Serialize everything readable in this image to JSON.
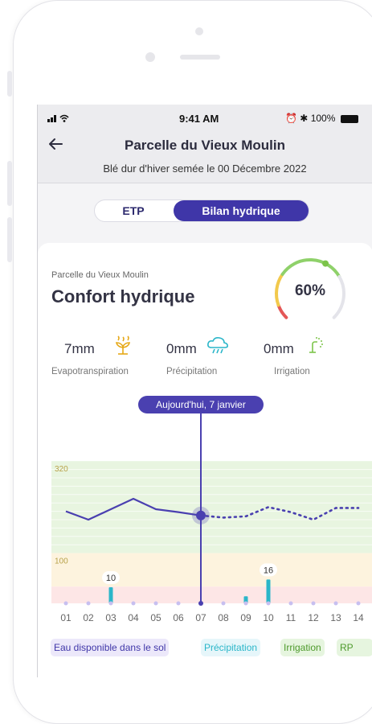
{
  "status": {
    "time": "9:41 AM",
    "battery": "100%"
  },
  "header": {
    "back_icon": "arrow-left-icon",
    "title": "Parcelle du Vieux Moulin",
    "subtitle": "Blé dur d'hiver semée le 00 Décembre 2022"
  },
  "tabs": {
    "etp": "ETP",
    "bilan": "Bilan hydrique",
    "active": "bilan"
  },
  "card": {
    "label": "Parcelle du Vieux Moulin",
    "title": "Confort hydrique",
    "gauge": {
      "value": "60%",
      "fraction": 0.6
    }
  },
  "metrics": [
    {
      "value": "7mm",
      "label": "Evapotranspiration",
      "icon": "evapotranspiration-icon",
      "color": "#e6a817"
    },
    {
      "value": "0mm",
      "label": "Précipitation",
      "icon": "rain-cloud-icon",
      "color": "#2bb6c9"
    },
    {
      "value": "0mm",
      "label": "Irrigation",
      "icon": "sprinkler-icon",
      "color": "#7cc44a"
    }
  ],
  "chart_data": {
    "type": "line",
    "today_label": "Aujourd'hui, 7 janvier",
    "today_index": 6,
    "categories": [
      "01",
      "02",
      "03",
      "04",
      "05",
      "06",
      "07",
      "08",
      "09",
      "10",
      "11",
      "12",
      "13",
      "14"
    ],
    "y_ticks": [
      "320",
      "100"
    ],
    "ylim": [
      -20,
      380
    ],
    "zones": [
      {
        "from": 100,
        "to": 320,
        "color": "#e8f5e0"
      },
      {
        "from": 20,
        "to": 100,
        "color": "#fdf3de"
      },
      {
        "from": -20,
        "to": 20,
        "color": "#fde6e6"
      }
    ],
    "soil_water": [
      200,
      180,
      205,
      230,
      205,
      198,
      190,
      185,
      188,
      210,
      198,
      180,
      208,
      208
    ],
    "soil_water_solid_until": 6,
    "precipitation": [
      0,
      0,
      10,
      0,
      0,
      0,
      0,
      0,
      3,
      16,
      0,
      0,
      0,
      0
    ],
    "precipitation_labels": {
      "2": "10",
      "9": "16"
    },
    "colors": {
      "line": "#4a40b0",
      "bar": "#2bb6c9",
      "dot": "#c7bff0"
    }
  },
  "legend": [
    "Eau disponible dans le sol",
    "Précipitation",
    "Irrigation",
    "RP"
  ]
}
